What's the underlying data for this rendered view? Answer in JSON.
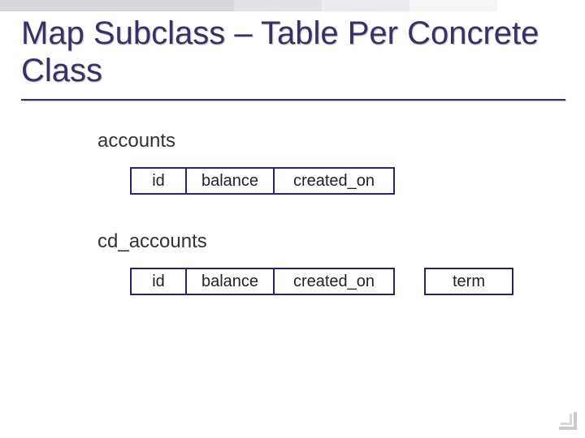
{
  "title": "Map Subclass – Table Per Concrete Class",
  "tables": {
    "accounts": {
      "label": "accounts",
      "columns": {
        "id": "id",
        "balance": "balance",
        "created_on": "created_on"
      }
    },
    "cd_accounts": {
      "label": "cd_accounts",
      "columns": {
        "id": "id",
        "balance": "balance",
        "created_on": "created_on",
        "term": "term"
      }
    }
  }
}
